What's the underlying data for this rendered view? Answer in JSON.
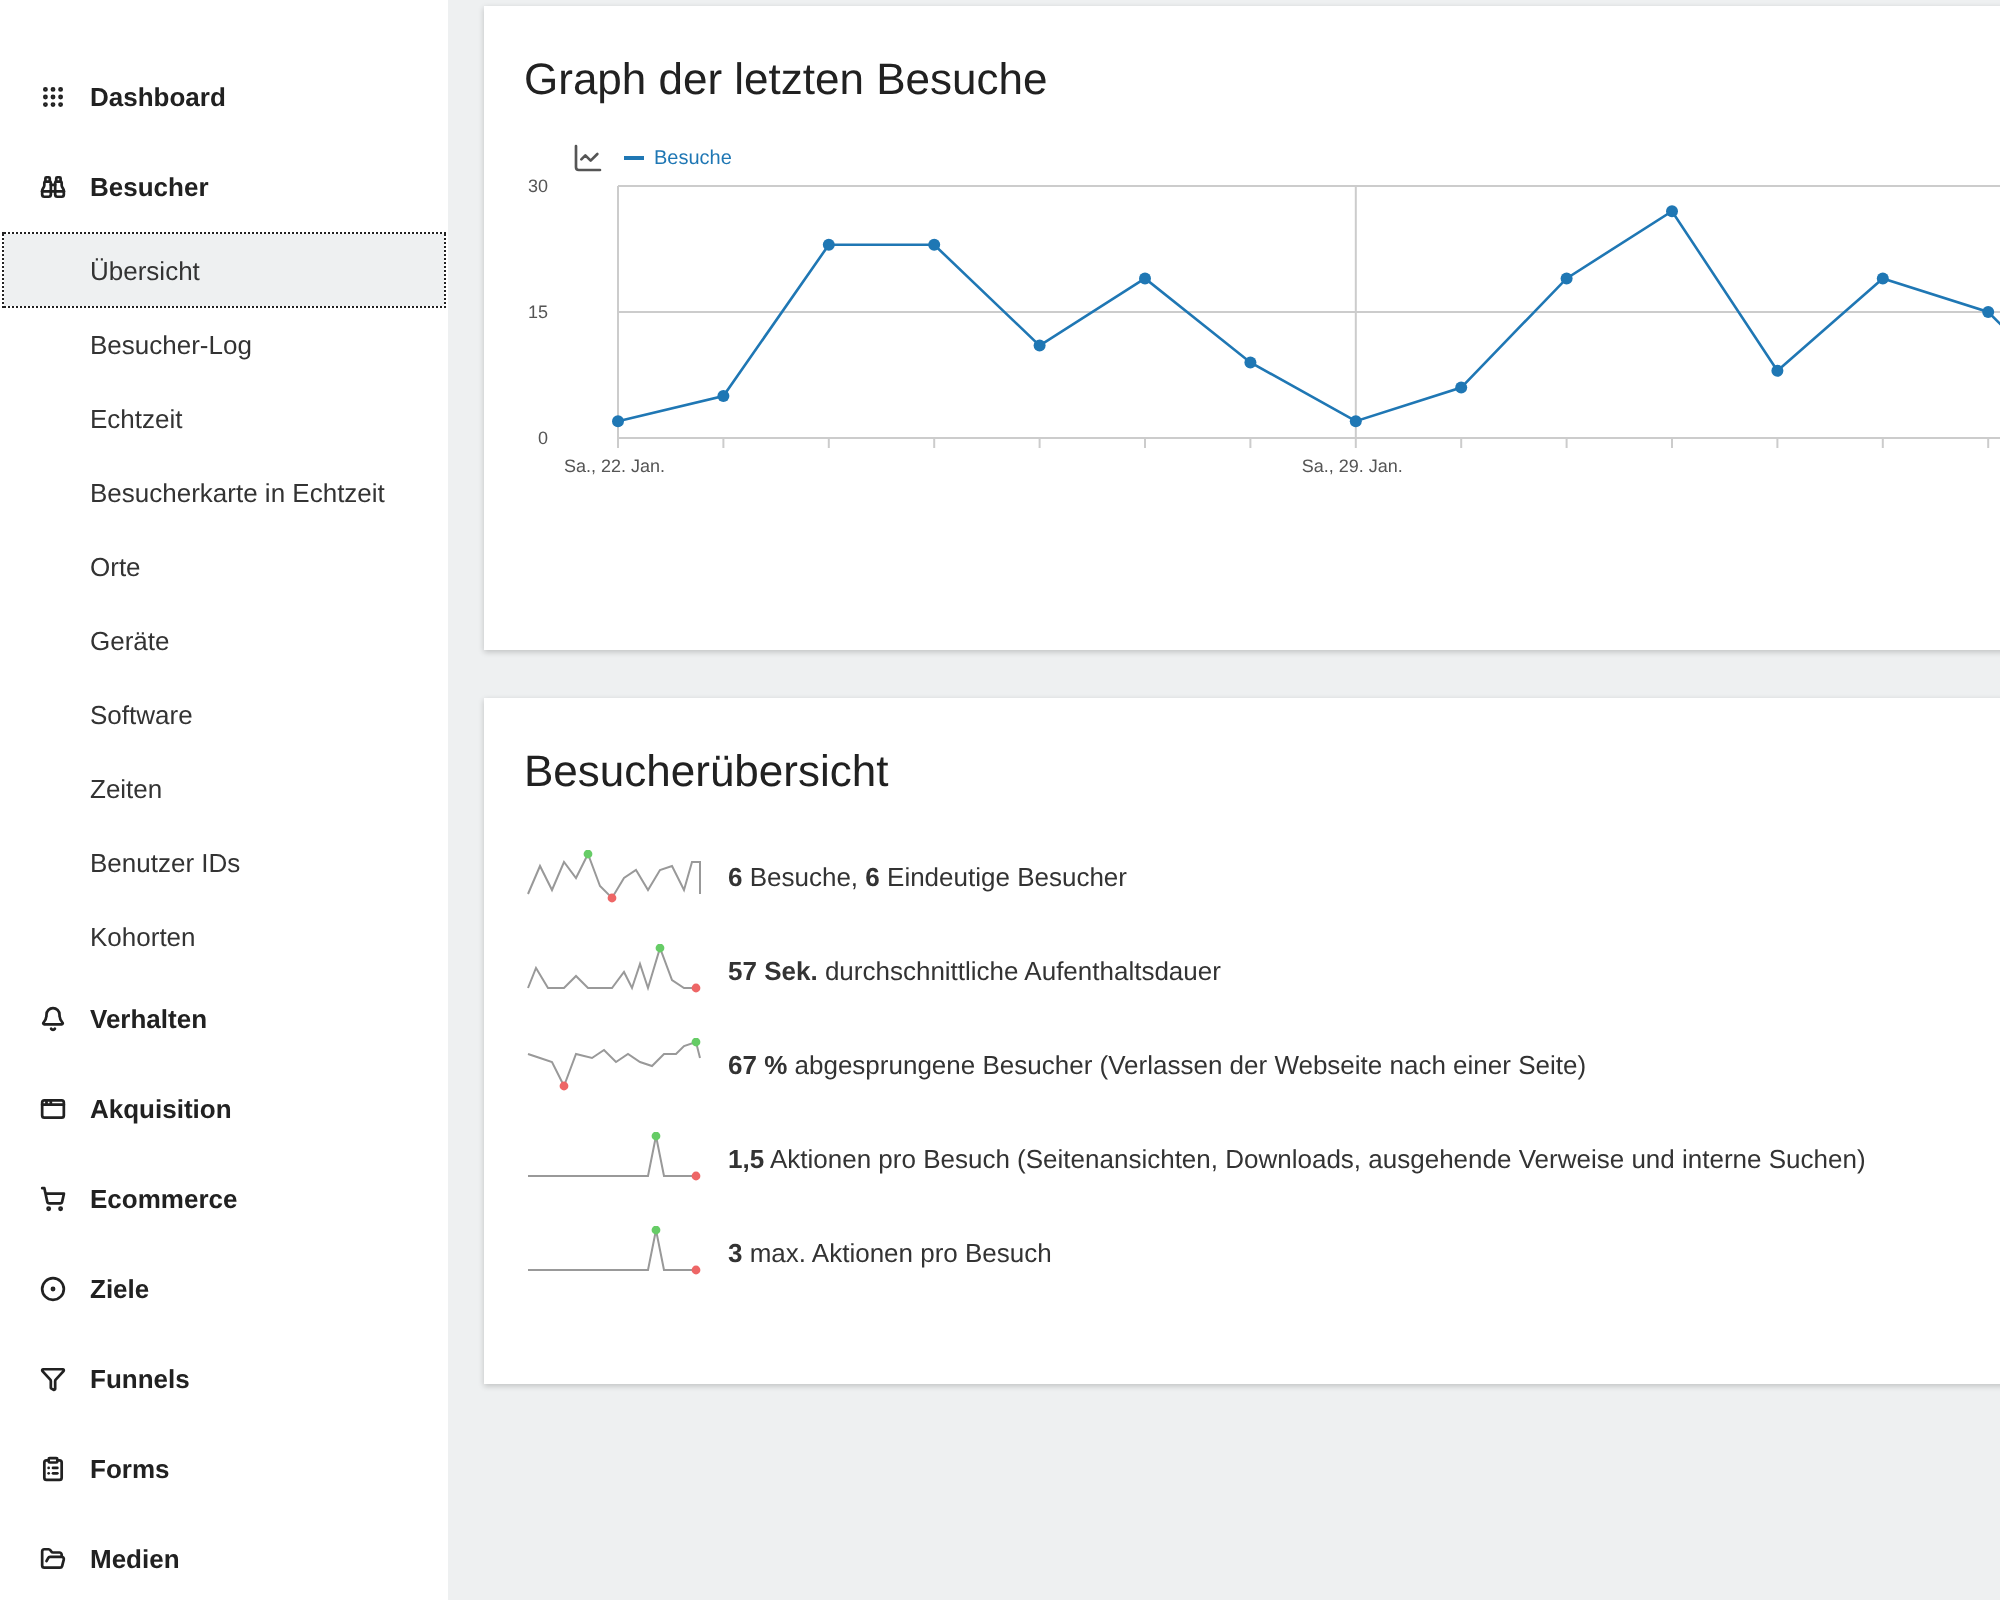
{
  "sidebar": {
    "items": [
      {
        "label": "Dashboard"
      },
      {
        "label": "Besucher",
        "children": [
          {
            "label": "Übersicht",
            "selected": true
          },
          {
            "label": "Besucher-Log",
            "selected": false
          },
          {
            "label": "Echtzeit",
            "selected": false
          },
          {
            "label": "Besucherkarte in Echtzeit",
            "selected": false
          },
          {
            "label": "Orte",
            "selected": false
          },
          {
            "label": "Geräte",
            "selected": false
          },
          {
            "label": "Software",
            "selected": false
          },
          {
            "label": "Zeiten",
            "selected": false
          },
          {
            "label": "Benutzer IDs",
            "selected": false
          },
          {
            "label": "Kohorten",
            "selected": false
          }
        ]
      },
      {
        "label": "Verhalten"
      },
      {
        "label": "Akquisition"
      },
      {
        "label": "Ecommerce"
      },
      {
        "label": "Ziele"
      },
      {
        "label": "Funnels"
      },
      {
        "label": "Forms"
      },
      {
        "label": "Medien"
      }
    ]
  },
  "graph_card": {
    "title": "Graph der letzten Besuche",
    "chart_data": {
      "type": "line",
      "categories": [
        "Sa., 22. Jan.",
        null,
        null,
        null,
        null,
        null,
        null,
        "Sa., 29. Jan.",
        null,
        null,
        null,
        null,
        null,
        null
      ],
      "series": [
        {
          "name": "Besuche",
          "color": "#1f77b4",
          "marker": "circle",
          "values": [
            2,
            5,
            23,
            23,
            11,
            19,
            9,
            2,
            6,
            19,
            27,
            8,
            19,
            15
          ]
        }
      ],
      "ylim": [
        0,
        30
      ],
      "yticks": [
        0,
        15,
        30
      ]
    }
  },
  "overview_card": {
    "title": "Besucherübersicht",
    "rows": [
      {
        "text": "**6** Besuche, **6** Eindeutige Besucher"
      },
      {
        "text": "**57 Sek.** durchschnittliche Aufenthaltsdauer"
      },
      {
        "text": "**67 %** abgesprungene Besucher (Verlassen der Webseite nach einer Seite)"
      },
      {
        "text": "**1,5** Aktionen pro Besuch (Seitenansichten, Downloads, ausgehende Verweise und interne Suchen)"
      },
      {
        "text": "**3** max. Aktionen pro Besuch"
      }
    ]
  }
}
